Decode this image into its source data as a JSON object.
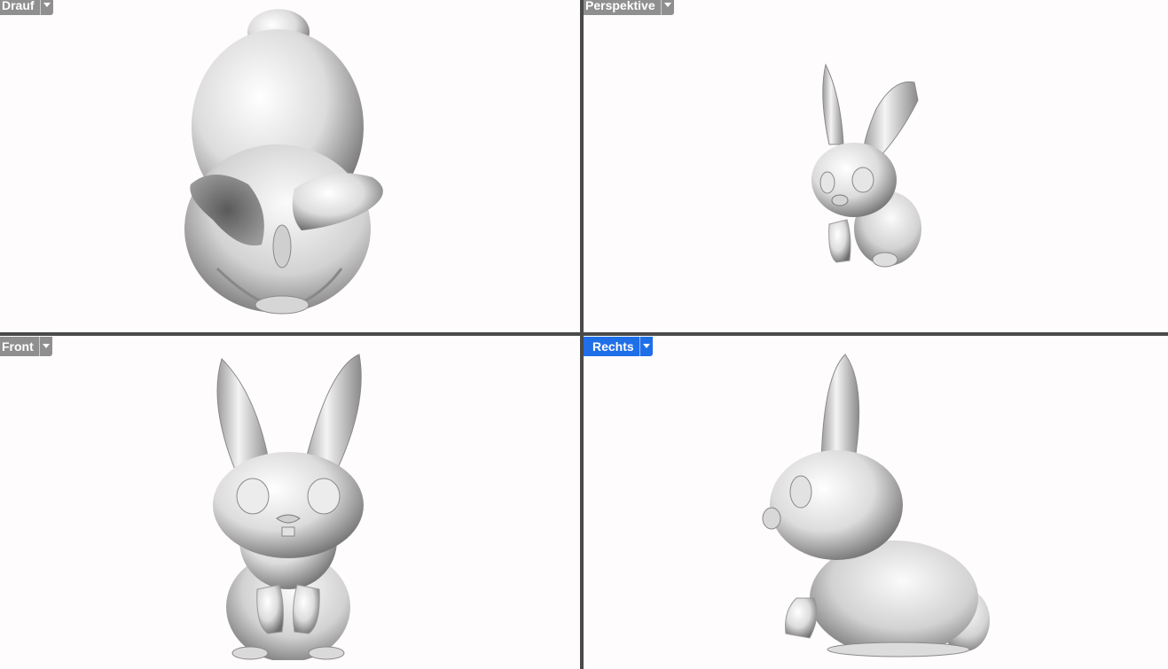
{
  "viewports": {
    "top": {
      "label": "Drauf",
      "active": false,
      "model_icon": "rabbit-top-view"
    },
    "persp": {
      "label": "Perspektive",
      "active": false,
      "model_icon": "rabbit-perspective-view"
    },
    "front": {
      "label": "Front",
      "active": false,
      "model_icon": "rabbit-front-view"
    },
    "right": {
      "label": "Rechts",
      "active": true,
      "model_icon": "rabbit-right-view"
    }
  },
  "colors": {
    "background": "#fefcfd",
    "divider": "#4a4a4a",
    "tab_inactive": "#8f8f8f",
    "tab_active": "#1f6fe8",
    "model_shade": "#bcbcbc"
  }
}
